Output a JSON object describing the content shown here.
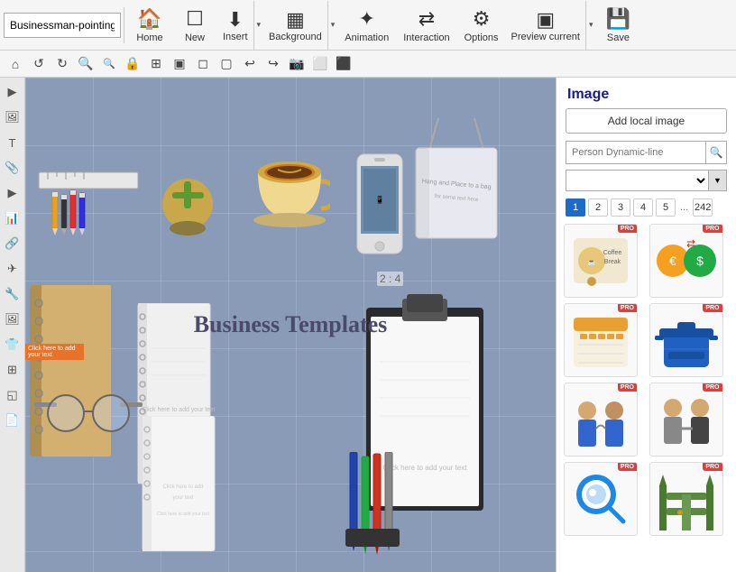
{
  "namebox": {
    "value": "Businessman-pointing"
  },
  "toolbar": {
    "home_label": "Home",
    "new_label": "New",
    "insert_label": "Insert",
    "background_label": "Background",
    "animation_label": "Animation",
    "interaction_label": "Interaction",
    "options_label": "Options",
    "preview_label": "Preview current",
    "save_label": "Save",
    "dropdown_arrow": "▾"
  },
  "toolbar2": {
    "buttons": [
      "⌂",
      "↺",
      "↻",
      "🔍+",
      "🔍-",
      "🔒",
      "⊞",
      "▣",
      "▢",
      "◻",
      "↩",
      "↪",
      "📷",
      "⬜",
      "⬛"
    ]
  },
  "sidebar": {
    "icons": [
      "▶",
      "T",
      "📎",
      "⚙",
      "✈",
      "🔧",
      "🔗",
      "📋",
      "🖼",
      "👕",
      "⊞",
      "◱",
      "📄"
    ]
  },
  "canvas": {
    "title": "Business Templates",
    "orange_tag_text": "Click here to add your text"
  },
  "right_panel": {
    "title": "Image",
    "add_local_label": "Add local image",
    "search_placeholder": "Person Dynamic-line",
    "pagination": {
      "pages": [
        "1",
        "2",
        "3",
        "4",
        "5"
      ],
      "ellipsis": "...",
      "last": "242",
      "active": "1"
    }
  },
  "images": [
    {
      "id": "img1",
      "pro": true,
      "type": "coffee-break"
    },
    {
      "id": "img2",
      "pro": true,
      "type": "money-exchange"
    },
    {
      "id": "img3",
      "pro": true,
      "type": "calendar-list"
    },
    {
      "id": "img4",
      "pro": true,
      "type": "pot-blue"
    },
    {
      "id": "img5",
      "pro": true,
      "type": "handshake1"
    },
    {
      "id": "img6",
      "pro": true,
      "type": "handshake2"
    },
    {
      "id": "img7",
      "pro": true,
      "type": "search-blue"
    },
    {
      "id": "img8",
      "pro": true,
      "type": "fence-gate"
    }
  ]
}
